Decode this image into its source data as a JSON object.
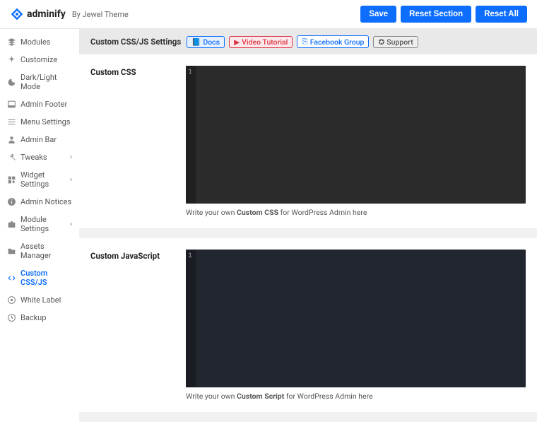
{
  "brand": {
    "name": "adminify",
    "sub": "By Jewel Theme"
  },
  "header_buttons": {
    "save": "Save",
    "reset_section": "Reset Section",
    "reset_all": "Reset All"
  },
  "sidebar": {
    "items": [
      {
        "label": "Modules",
        "chevron": false
      },
      {
        "label": "Customize",
        "chevron": false
      },
      {
        "label": "Dark/Light Mode",
        "chevron": false
      },
      {
        "label": "Admin Footer",
        "chevron": false
      },
      {
        "label": "Menu Settings",
        "chevron": false
      },
      {
        "label": "Admin Bar",
        "chevron": false
      },
      {
        "label": "Tweaks",
        "chevron": true
      },
      {
        "label": "Widget Settings",
        "chevron": true
      },
      {
        "label": "Admin Notices",
        "chevron": false
      },
      {
        "label": "Module Settings",
        "chevron": true
      },
      {
        "label": "Assets Manager",
        "chevron": false
      },
      {
        "label": "Custom CSS/JS",
        "chevron": false
      },
      {
        "label": "White Label",
        "chevron": false
      },
      {
        "label": "Backup",
        "chevron": false
      }
    ]
  },
  "section": {
    "title": "Custom CSS/JS Settings",
    "links": {
      "docs": "Docs",
      "video": "Video Tutorial",
      "fb": "Facebook Group",
      "support": "Support"
    }
  },
  "css_panel": {
    "label": "Custom CSS",
    "line": "1",
    "help_pre": "Write your own ",
    "help_bold": "Custom CSS",
    "help_post": " for WordPress Admin here"
  },
  "js_panel": {
    "label": "Custom JavaScript",
    "line": "1",
    "help_pre": "Write your own ",
    "help_bold": "Custom Script",
    "help_post": " for WordPress Admin here"
  }
}
